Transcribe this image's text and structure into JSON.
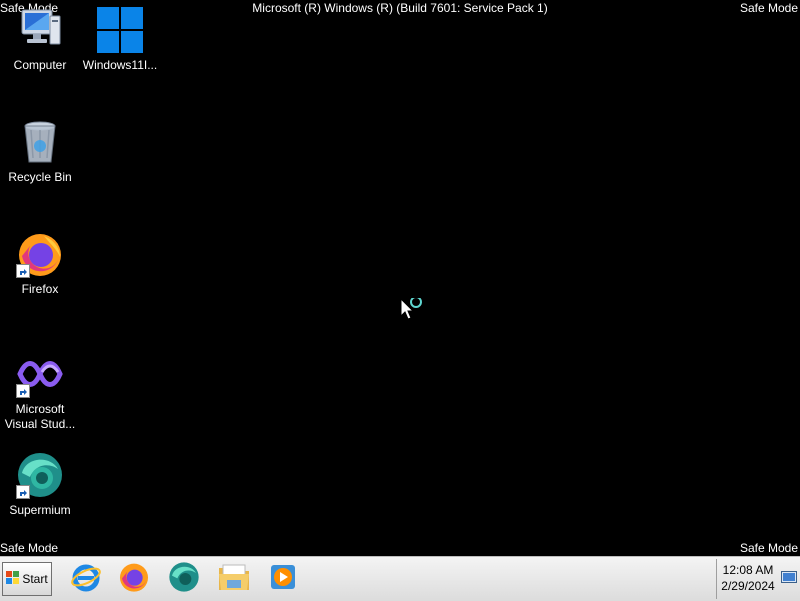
{
  "overlay": {
    "banner": "Microsoft (R) Windows (R) (Build 7601: Service Pack 1)",
    "safe_mode": "Safe Mode"
  },
  "desktop": {
    "icons": [
      {
        "label": "Computer",
        "icon": "computer-icon"
      },
      {
        "label": "Windows11I...",
        "icon": "windows-logo-icon"
      },
      {
        "label": "Recycle Bin",
        "icon": "recycle-bin-icon"
      },
      {
        "label": "Firefox",
        "icon": "firefox-icon"
      },
      {
        "label": "Microsoft Visual Stud...",
        "icon": "visual-studio-icon"
      },
      {
        "label": "Supermium",
        "icon": "supermium-icon"
      }
    ]
  },
  "taskbar": {
    "start_label": "Start",
    "pinned": [
      {
        "name": "Internet Explorer",
        "icon": "internet-explorer-icon"
      },
      {
        "name": "Firefox",
        "icon": "firefox-icon"
      },
      {
        "name": "Supermium",
        "icon": "supermium-icon"
      },
      {
        "name": "Windows Explorer",
        "icon": "folder-icon"
      },
      {
        "name": "Windows Media Player",
        "icon": "media-player-icon"
      }
    ],
    "clock": {
      "time": "12:08 AM",
      "date": "2/29/2024"
    }
  },
  "colors": {
    "desktop_background": "#000000",
    "taskbar": "#e6e6e6",
    "text": "#ffffff",
    "windows_blue": "#0a84e8"
  }
}
